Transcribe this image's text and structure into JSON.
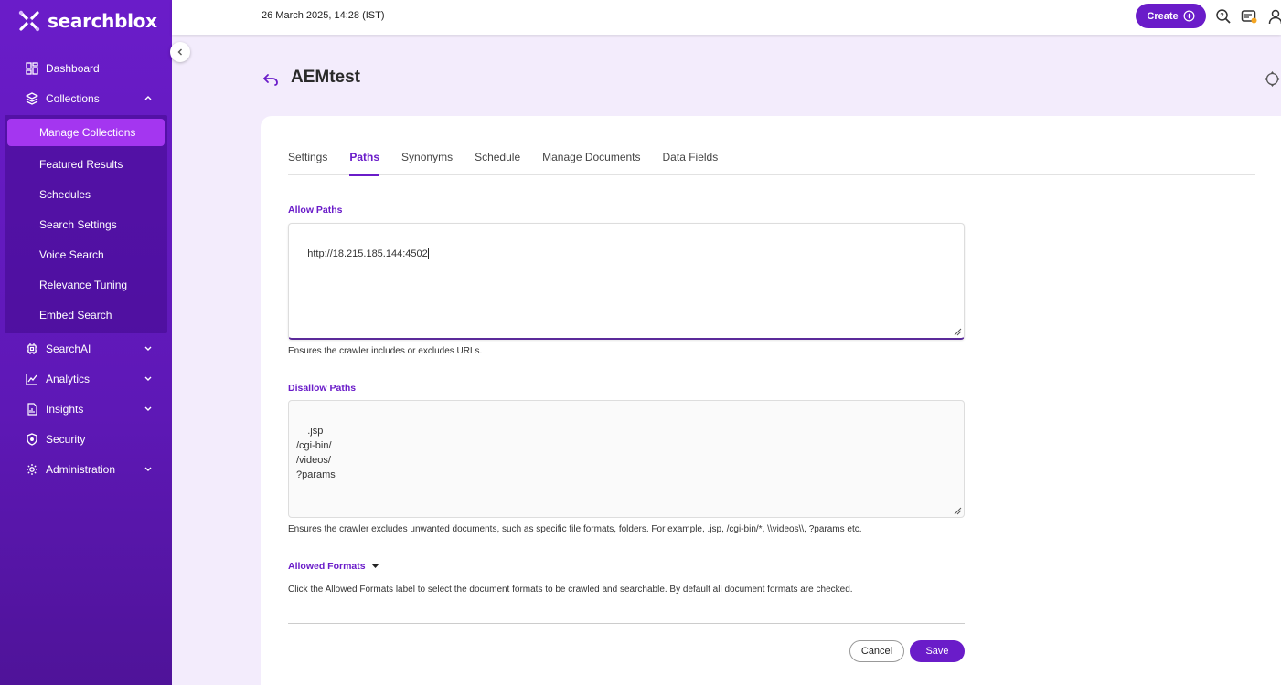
{
  "app": {
    "name": "searchblox"
  },
  "sidebar": {
    "items": [
      {
        "label": "Dashboard",
        "icon": "dashboard-icon"
      },
      {
        "label": "Collections",
        "icon": "layers-icon",
        "expanded": true,
        "children": [
          {
            "label": "Manage Collections",
            "active": true
          },
          {
            "label": "Featured Results"
          },
          {
            "label": "Schedules"
          },
          {
            "label": "Search Settings"
          },
          {
            "label": "Voice Search"
          },
          {
            "label": "Relevance Tuning"
          },
          {
            "label": "Embed Search"
          }
        ]
      },
      {
        "label": "SearchAI",
        "icon": "chip-icon"
      },
      {
        "label": "Analytics",
        "icon": "analytics-icon"
      },
      {
        "label": "Insights",
        "icon": "insights-icon"
      },
      {
        "label": "Security",
        "icon": "shield-icon"
      },
      {
        "label": "Administration",
        "icon": "gear-icon"
      }
    ]
  },
  "topbar": {
    "datetime": "26 March 2025, 14:28 (IST)",
    "create_label": "Create"
  },
  "page": {
    "title": "AEMtest"
  },
  "tabs": [
    {
      "label": "Settings"
    },
    {
      "label": "Paths",
      "active": true
    },
    {
      "label": "Synonyms"
    },
    {
      "label": "Schedule"
    },
    {
      "label": "Manage Documents"
    },
    {
      "label": "Data Fields"
    }
  ],
  "allow_paths": {
    "label": "Allow Paths",
    "value": "http://18.215.185.144:4502",
    "helper": "Ensures the crawler includes or excludes URLs."
  },
  "disallow_paths": {
    "label": "Disallow Paths",
    "value": ".jsp\n/cgi-bin/\n/videos/\n?params",
    "helper": "Ensures the crawler excludes unwanted documents, such as specific file formats, folders. For example, .jsp, /cgi-bin/*, \\\\videos\\\\, ?params etc."
  },
  "allowed_formats": {
    "label": "Allowed Formats",
    "helper": "Click the Allowed Formats label to select the document formats to be crawled and searchable. By default all document formats are checked."
  },
  "actions": {
    "cancel_label": "Cancel",
    "save_label": "Save"
  },
  "colors": {
    "brand": "#6a1cc9",
    "active_nav": "#a436f0",
    "background": "#f3ecfc"
  }
}
